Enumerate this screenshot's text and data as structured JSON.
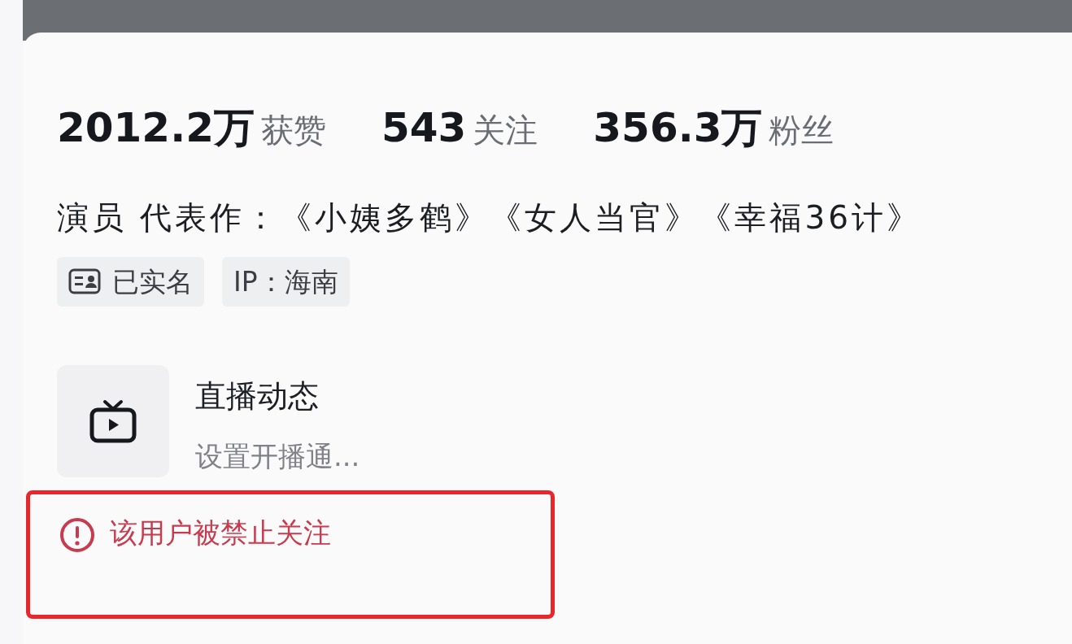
{
  "stats": [
    {
      "count": "2012.2万",
      "unit": "获赞"
    },
    {
      "count": "543",
      "unit": "关注"
    },
    {
      "count": "356.3万",
      "unit": "粉丝"
    }
  ],
  "bio": "演员 代表作：《小姨多鹤》《女人当官》《幸福36计》",
  "tags": [
    {
      "kind": "verified",
      "text": "已实名"
    },
    {
      "kind": "ip",
      "text": "IP：海南"
    }
  ],
  "live": {
    "title": "直播动态",
    "subtitle": "设置开播通..."
  },
  "notice": {
    "text": "该用户被禁止关注",
    "highlighted": true
  }
}
